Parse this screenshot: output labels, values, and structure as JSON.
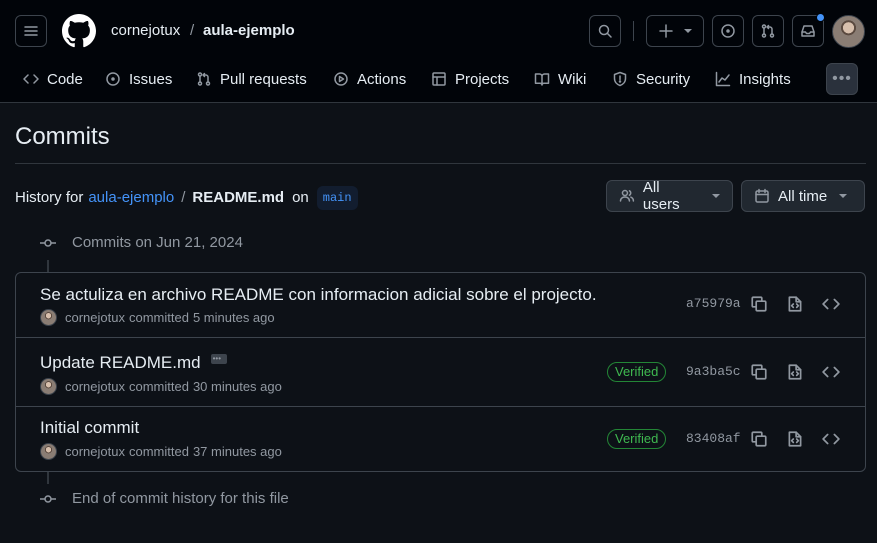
{
  "header": {
    "owner": "cornejotux",
    "separator": "/",
    "repo": "aula-ejemplo"
  },
  "tabs": [
    {
      "label": "Code",
      "icon": "code-icon"
    },
    {
      "label": "Issues",
      "icon": "issue-icon"
    },
    {
      "label": "Pull requests",
      "icon": "pull-request-icon"
    },
    {
      "label": "Actions",
      "icon": "play-icon"
    },
    {
      "label": "Projects",
      "icon": "table-icon"
    },
    {
      "label": "Wiki",
      "icon": "book-icon"
    },
    {
      "label": "Security",
      "icon": "shield-icon"
    },
    {
      "label": "Insights",
      "icon": "graph-icon"
    }
  ],
  "page": {
    "title": "Commits",
    "history_prefix": "History for",
    "history_repo": "aula-ejemplo",
    "history_sep": "/",
    "history_file": "README.md",
    "history_on": "on",
    "branch": "main"
  },
  "filters": {
    "users": "All users",
    "time": "All time"
  },
  "timeline": {
    "group_label": "Commits on Jun 21, 2024",
    "end_label": "End of commit history for this file"
  },
  "commits": [
    {
      "message": "Se actuliza en archivo README con informacion adicial sobre el projecto.",
      "author": "cornejotux",
      "action": "committed",
      "time": "5 minutes ago",
      "verified": "",
      "sha": "a75979a"
    },
    {
      "message": "Update README.md",
      "author": "cornejotux",
      "action": "committed",
      "time": "30 minutes ago",
      "verified": "Verified",
      "sha": "9a3ba5c"
    },
    {
      "message": "Initial commit",
      "author": "cornejotux",
      "action": "committed",
      "time": "37 minutes ago",
      "verified": "Verified",
      "sha": "83408af"
    }
  ],
  "colors": {
    "background": "#0d1117",
    "header_bg": "#010409",
    "link": "#4493f8",
    "verified": "#3fb950",
    "notification": "#4493f8"
  }
}
